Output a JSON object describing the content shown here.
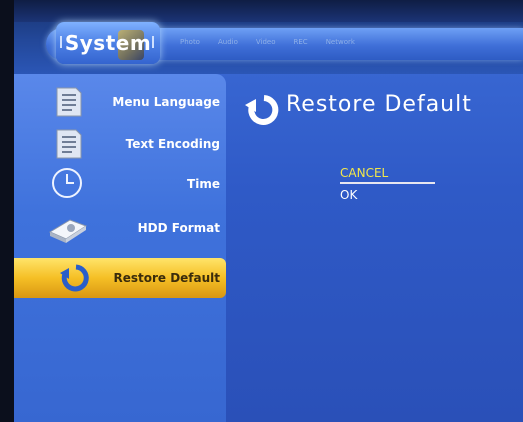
{
  "header": {
    "active_tab": "System",
    "tabs": [
      "Photo",
      "Audio",
      "Video",
      "REC",
      "Network"
    ]
  },
  "sidebar": {
    "items": [
      {
        "label": "Menu Language",
        "icon": "document-icon"
      },
      {
        "label": "Text Encoding",
        "icon": "document-icon"
      },
      {
        "label": "Time",
        "icon": "clock-icon"
      },
      {
        "label": "HDD Format",
        "icon": "hdd-icon"
      },
      {
        "label": "Restore Default",
        "icon": "restore-icon",
        "selected": true
      }
    ]
  },
  "main": {
    "title": "Restore Default",
    "title_icon": "restore-icon",
    "options": [
      "CANCEL",
      "OK"
    ],
    "highlighted_option": "CANCEL"
  },
  "colors": {
    "accent": "#f5bf25",
    "background": "#3767d1",
    "highlight_text": "#f2e74a"
  }
}
